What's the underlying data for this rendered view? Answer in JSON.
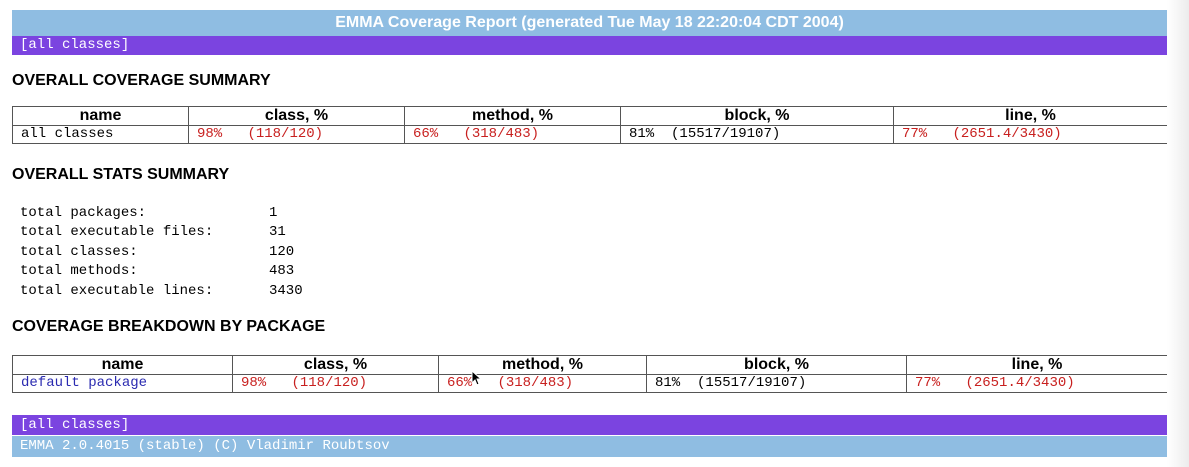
{
  "header": {
    "title": "EMMA Coverage Report (generated Tue May 18 22:20:04 CDT 2004)",
    "nav_link": "[all classes]"
  },
  "overall_coverage": {
    "heading": "OVERALL COVERAGE SUMMARY",
    "columns": [
      "name",
      "class, %",
      "method, %",
      "block, %",
      "line, %"
    ],
    "row": {
      "name": "all classes",
      "class_pct": "98%",
      "class_ratio": "(118/120)",
      "method_pct": "66%",
      "method_ratio": "(318/483)",
      "block_pct": "81%",
      "block_ratio": "(15517/19107)",
      "line_pct": "77%",
      "line_ratio": "(2651.4/3430)"
    }
  },
  "overall_stats": {
    "heading": "OVERALL STATS SUMMARY",
    "items": [
      {
        "label": "total packages:",
        "value": "1"
      },
      {
        "label": "total executable files:",
        "value": "31"
      },
      {
        "label": "total classes:",
        "value": "120"
      },
      {
        "label": "total methods:",
        "value": "483"
      },
      {
        "label": "total executable lines:",
        "value": "3430"
      }
    ]
  },
  "package_breakdown": {
    "heading": "COVERAGE BREAKDOWN BY PACKAGE",
    "columns": [
      "name",
      "class, %",
      "method, %",
      "block, %",
      "line, %"
    ],
    "row": {
      "name": "default package",
      "class_pct": "98%",
      "class_ratio": "(118/120)",
      "method_pct": "66%",
      "method_ratio": "(318/483)",
      "block_pct": "81%",
      "block_ratio": "(15517/19107)",
      "line_pct": "77%",
      "line_ratio": "(2651.4/3430)"
    }
  },
  "footer": {
    "nav_link": "[all classes]",
    "credits": "EMMA 2.0.4015 (stable) (C) Vladimir Roubtsov"
  },
  "colors": {
    "title_bar": "#8fbde2",
    "nav_bar": "#7b44e0",
    "low_coverage": "#c8201f",
    "link": "#2a2ab0"
  }
}
